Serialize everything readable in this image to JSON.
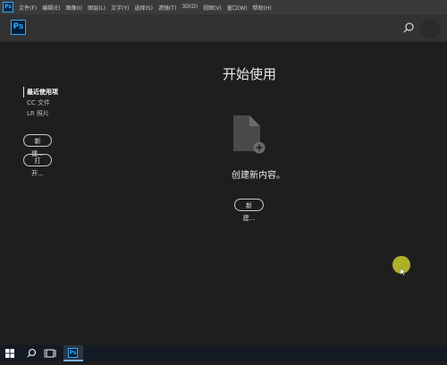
{
  "app": {
    "logo_text": "Ps"
  },
  "menubar": {
    "items": [
      "文件(F)",
      "编辑(E)",
      "图像(I)",
      "图层(L)",
      "文字(Y)",
      "选择(S)",
      "滤镜(T)",
      "3D(D)",
      "视图(V)",
      "窗口(W)",
      "帮助(H)"
    ]
  },
  "header": {
    "search_icon": "search-icon",
    "account": "avatar"
  },
  "main": {
    "title": "开始使用",
    "create_text": "创建新内容。",
    "new_button": "新建..."
  },
  "sidebar": {
    "items": [
      {
        "label": "最近使用项",
        "active": true
      },
      {
        "label": "CC 文件",
        "active": false
      },
      {
        "label": "LR 照片",
        "active": false
      }
    ],
    "new_button": "新建...",
    "open_button": "打开..."
  },
  "taskbar": {
    "icons": [
      "windows-icon",
      "search-icon",
      "task-view-icon",
      "photoshop-icon"
    ],
    "ps_label": "Ps"
  },
  "colors": {
    "accent": "#31a8ff",
    "background": "#1e1e1e",
    "header": "#323232",
    "cursor": "#bfbf2a"
  }
}
